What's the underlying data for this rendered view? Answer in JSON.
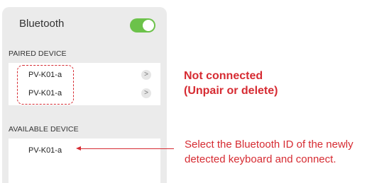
{
  "bluetooth": {
    "title": "Bluetooth",
    "toggle_on": true
  },
  "paired_section": {
    "label": "PAIRED DEVICE",
    "devices": [
      {
        "name": "PV-K01-a",
        "chevron": ">"
      },
      {
        "name": "PV-K01-a",
        "chevron": ">"
      }
    ]
  },
  "available_section": {
    "label": "AVAILABLE DEVICE",
    "devices": [
      {
        "name": "PV-K01-a"
      }
    ]
  },
  "annotations": {
    "not_connected_line1": "Not connected",
    "not_connected_line2": "(Unpair or delete)",
    "select_line1": "Select the Bluetooth ID of the newly",
    "select_line2": "detected keyboard and connect."
  },
  "colors": {
    "accent_red": "#d62b32",
    "toggle_green": "#6cc24a",
    "panel_bg": "#ebebeb"
  }
}
